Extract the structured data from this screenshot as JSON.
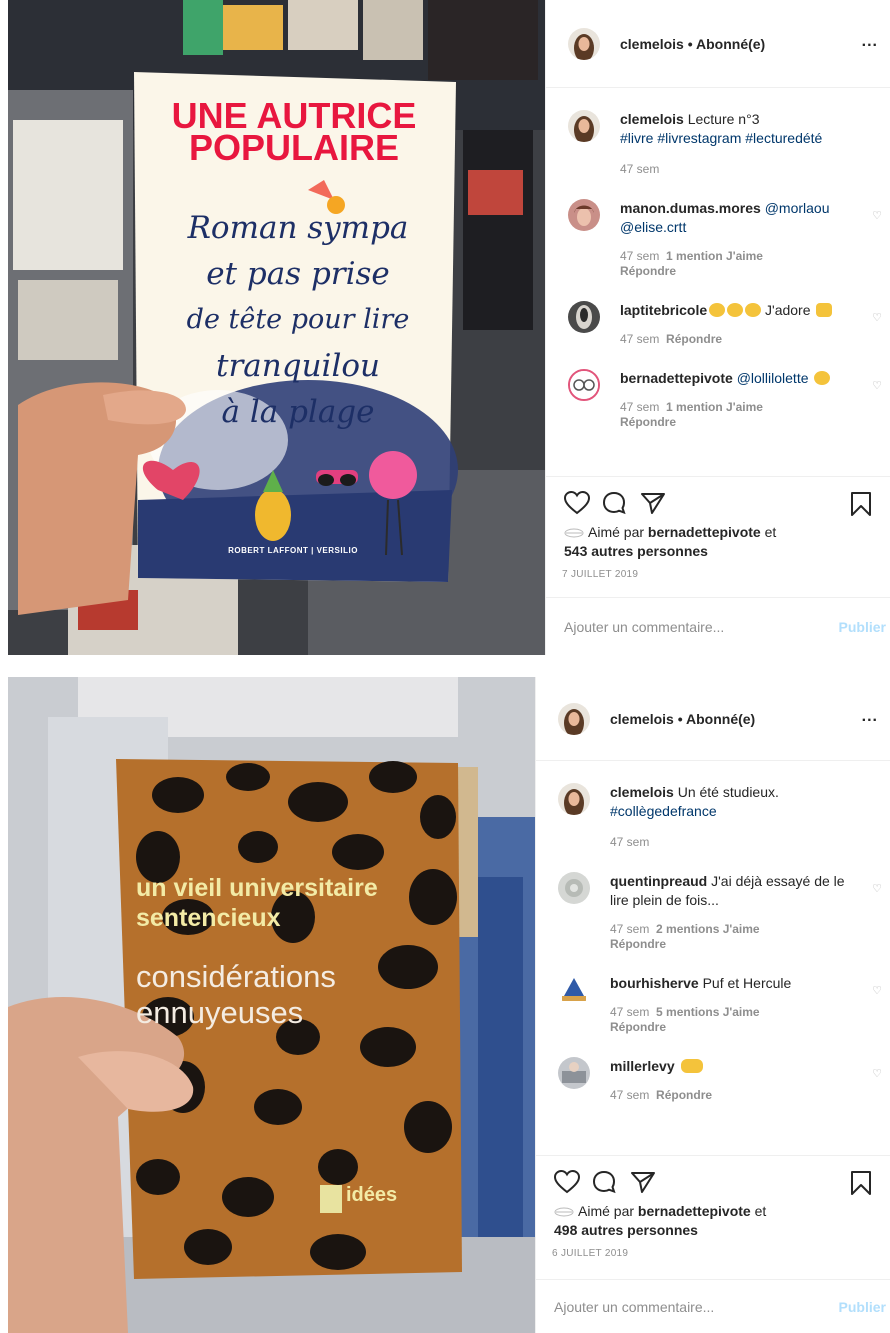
{
  "posts": [
    {
      "header": {
        "username": "clemelois",
        "separator": " • ",
        "follow_status": "Abonné(e)",
        "more": "..."
      },
      "cover": {
        "title_line1": "UNE AUTRICE",
        "title_line2": "POPULAIRE",
        "script_lines": [
          "Roman sympa",
          "et pas prise",
          "de tête pour lire",
          "tranquilou",
          "à la plage"
        ],
        "publisher": "ROBERT LAFFONT | VERSILIO"
      },
      "caption": {
        "user": "clemelois",
        "text": " Lecture n°3",
        "hashtags": "#livre #livrestagram #lecturedété",
        "age": "47 sem"
      },
      "comments": [
        {
          "user": "manon.dumas.mores",
          "text": " @morlaou @elise.crtt",
          "age": "47 sem",
          "likes": "1 mention J'aime",
          "reply": "Répondre"
        },
        {
          "user": "laptitebricole",
          "text": " J'adore ",
          "age": "47 sem",
          "likes": "",
          "reply": "Répondre"
        },
        {
          "user": "bernadettepivote",
          "text": " @lollilolette ",
          "age": "47 sem",
          "likes": "1 mention J'aime",
          "reply": "Répondre"
        }
      ],
      "likes": {
        "prefix": "Aimé par ",
        "user": "bernadettepivote",
        "middle": " et",
        "count": "543 autres personnes"
      },
      "date": "7 JUILLET 2019",
      "add_comment": {
        "placeholder": "Ajouter un commentaire...",
        "publish": "Publier"
      }
    },
    {
      "header": {
        "username": "clemelois",
        "separator": " • ",
        "follow_status": "Abonné(e)",
        "more": "..."
      },
      "cover": {
        "title_line1": "un vieil universitaire",
        "title_line2": "sentencieux",
        "sub_line1": "considérations",
        "sub_line2": "ennuyeuses",
        "publisher": "idées"
      },
      "caption": {
        "user": "clemelois",
        "text": " Un été studieux.",
        "hashtags": "#collègedefrance",
        "age": "47 sem"
      },
      "comments": [
        {
          "user": "quentinpreaud",
          "text": " J'ai déjà essayé de le lire plein de fois...",
          "age": "47 sem",
          "likes": "2 mentions J'aime",
          "reply": "Répondre"
        },
        {
          "user": "bourhisherve",
          "text": " Puf et Hercule",
          "age": "47 sem",
          "likes": "5 mentions J'aime",
          "reply": "Répondre"
        },
        {
          "user": "millerlevy",
          "text": " ",
          "age": "47 sem",
          "likes": "",
          "reply": "Répondre"
        }
      ],
      "likes": {
        "prefix": "Aimé par ",
        "user": "bernadettepivote",
        "middle": " et",
        "count": "498 autres personnes"
      },
      "date": "6 JUILLET 2019",
      "add_comment": {
        "placeholder": "Ajouter un commentaire...",
        "publish": "Publier"
      }
    }
  ],
  "icons": [
    "heart-icon",
    "comment-icon",
    "share-icon",
    "bookmark-icon",
    "comment-heart-icon"
  ],
  "colors": {
    "link": "#00376b",
    "publish": "#b2dffc",
    "meta": "#8e8e8e",
    "cover1_title": "#e8173f",
    "cover1_script": "#1d2f66",
    "cover2_bg": "#b5702c"
  }
}
